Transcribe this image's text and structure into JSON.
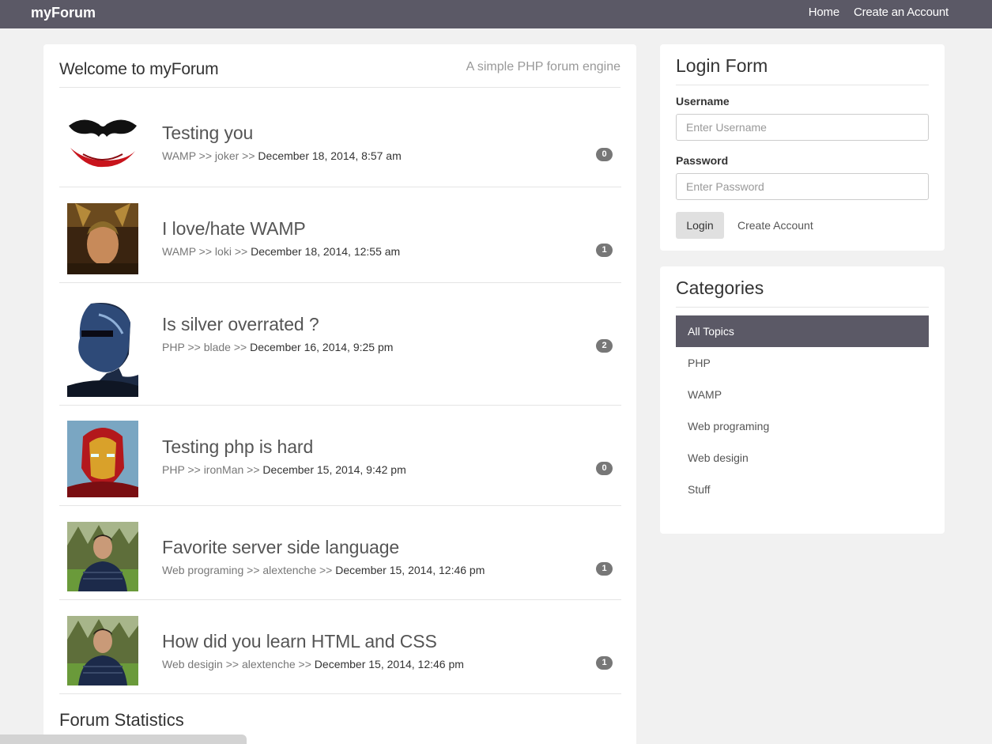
{
  "nav": {
    "brand": "myForum",
    "links": [
      "Home",
      "Create an Account"
    ]
  },
  "main": {
    "title": "Welcome to myForum",
    "subtitle": "A simple PHP forum engine",
    "topics": [
      {
        "title": "Testing you",
        "category": "WAMP",
        "author": "joker",
        "date": "December 18, 2014, 8:57 am",
        "replies": "0",
        "avatar": "joker-avatar"
      },
      {
        "title": "I love/hate WAMP",
        "category": "WAMP",
        "author": "loki",
        "date": "December 18, 2014, 12:55 am",
        "replies": "1",
        "avatar": "loki-avatar"
      },
      {
        "title": "Is silver overrated ?",
        "category": "PHP",
        "author": "blade",
        "date": "December 16, 2014, 9:25 pm",
        "replies": "2",
        "avatar": "blade-avatar"
      },
      {
        "title": "Testing php is hard",
        "category": "PHP",
        "author": "ironMan",
        "date": "December 15, 2014, 9:42 pm",
        "replies": "0",
        "avatar": "ironman-avatar"
      },
      {
        "title": "Favorite server side language",
        "category": "Web programing",
        "author": "alextenche",
        "date": "December 15, 2014, 12:46 pm",
        "replies": "1",
        "avatar": "photo-avatar"
      },
      {
        "title": "How did you learn HTML and CSS",
        "category": "Web desigin",
        "author": "alextenche",
        "date": "December 15, 2014, 12:46 pm",
        "replies": "1",
        "avatar": "photo-avatar"
      }
    ],
    "meta_separator": ">>",
    "stats_title": "Forum Statistics"
  },
  "login": {
    "title": "Login Form",
    "username_label": "Username",
    "username_placeholder": "Enter Username",
    "password_label": "Password",
    "password_placeholder": "Enter Password",
    "login_button": "Login",
    "create_account": "Create Account"
  },
  "categories": {
    "title": "Categories",
    "items": [
      "All Topics",
      "PHP",
      "WAMP",
      "Web programing",
      "Web desigin",
      "Stuff"
    ],
    "active": "All Topics"
  },
  "colors": {
    "navbar": "#5b5966",
    "badge": "#777777",
    "background": "#f1f1f1"
  }
}
